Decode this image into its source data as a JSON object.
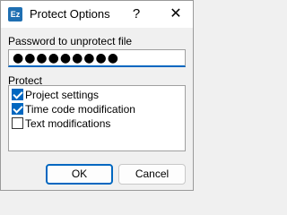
{
  "window": {
    "title": "Protect Options",
    "app_icon_text": "Ez",
    "help_glyph": "?",
    "close_glyph": "✕"
  },
  "password": {
    "label": "Password to unprotect file",
    "value": "●●●●●●●●●"
  },
  "protect": {
    "label": "Protect",
    "options": [
      {
        "label": "Project settings",
        "checked": true
      },
      {
        "label": "Time code modification",
        "checked": true
      },
      {
        "label": "Text modifications",
        "checked": false
      }
    ]
  },
  "buttons": {
    "ok": "OK",
    "cancel": "Cancel"
  },
  "colors": {
    "accent": "#0067c0",
    "app_icon": "#1f6fb2"
  }
}
